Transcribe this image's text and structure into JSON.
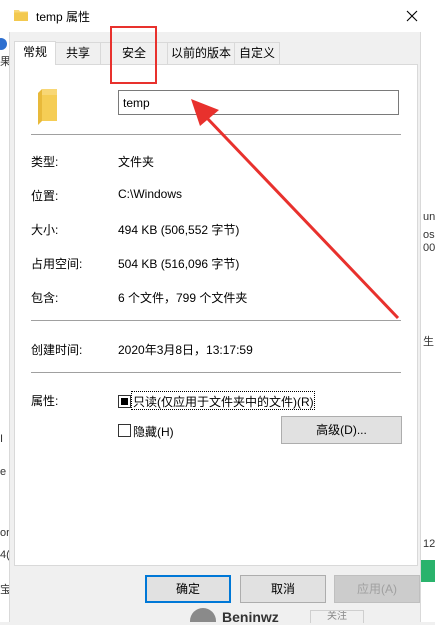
{
  "window": {
    "title": "temp 属性"
  },
  "tabs": [
    {
      "label": "常规"
    },
    {
      "label": "共享"
    },
    {
      "label": "安全"
    },
    {
      "label": "以前的版本"
    },
    {
      "label": "自定义"
    }
  ],
  "general": {
    "folder_name": "temp",
    "rows": [
      {
        "label": "类型:",
        "value": "文件夹"
      },
      {
        "label": "位置:",
        "value": "C:\\Windows"
      },
      {
        "label": "大小:",
        "value": "494 KB (506,552 字节)"
      },
      {
        "label": "占用空间:",
        "value": "504 KB (516,096 字节)"
      },
      {
        "label": "包含:",
        "value": "6 个文件，799 个文件夹"
      }
    ],
    "created_label": "创建时间:",
    "created_value": "2020年3月8日，13:17:59",
    "attributes_label": "属性:",
    "readonly_label": "只读(仅应用于文件夹中的文件)(R)",
    "hidden_label": "隐藏(H)",
    "advanced_label": "高级(D)..."
  },
  "buttons": {
    "ok": "确定",
    "cancel": "取消",
    "apply": "应用(A)"
  },
  "background": {
    "left": [
      "果",
      "I",
      "e",
      "or",
      "4(",
      "宝"
    ],
    "right": [
      "un",
      "os",
      "00",
      "生",
      "12"
    ],
    "bottom": [
      "Beninwz",
      "关注"
    ]
  },
  "colors": {
    "annotation": "#e8312d",
    "focus": "#0078d7",
    "folder": "#f8d775"
  }
}
